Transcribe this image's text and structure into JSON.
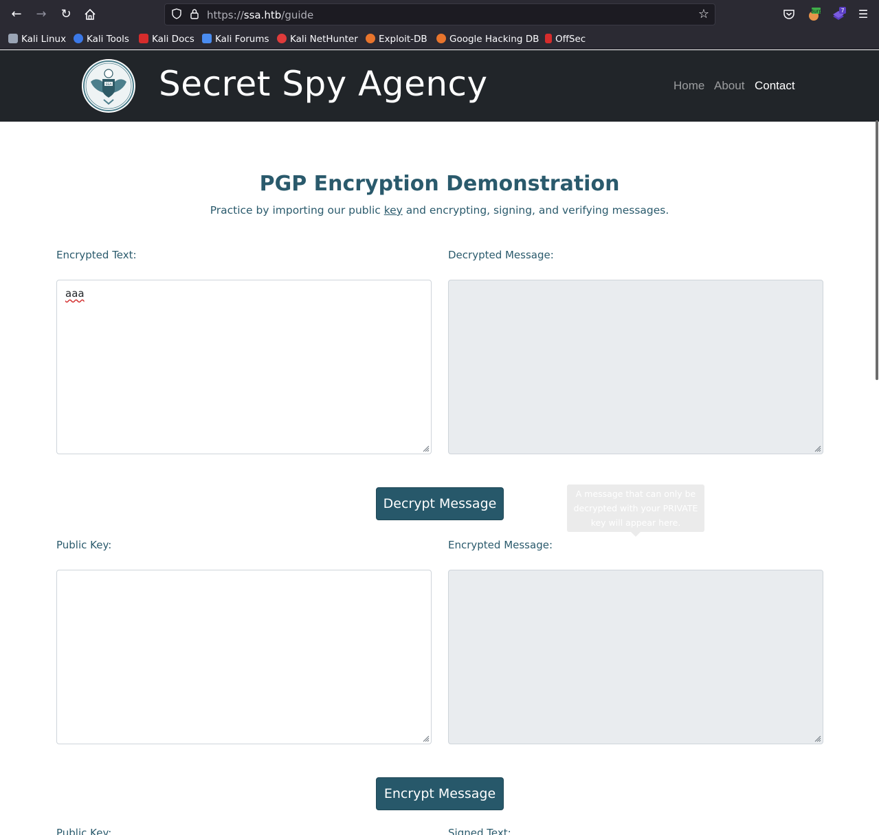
{
  "browser": {
    "url_scheme": "https://",
    "url_host": "ssa.htb",
    "url_path": "/guide",
    "bookmarks": [
      {
        "label": "Kali Linux",
        "icon": "kali-dragon-icon",
        "color": "#9aa4b5"
      },
      {
        "label": "Kali Tools",
        "icon": "kali-tools-icon",
        "color": "#3b78e7"
      },
      {
        "label": "Kali Docs",
        "icon": "kali-docs-icon",
        "color": "#d62c2c"
      },
      {
        "label": "Kali Forums",
        "icon": "kali-forums-icon",
        "color": "#4a8cf0"
      },
      {
        "label": "Kali NetHunter",
        "icon": "nethunter-icon",
        "color": "#e03b3b"
      },
      {
        "label": "Exploit-DB",
        "icon": "exploit-db-icon",
        "color": "#e8742c"
      },
      {
        "label": "Google Hacking DB",
        "icon": "ghdb-icon",
        "color": "#e8742c"
      },
      {
        "label": "OffSec",
        "icon": "offsec-icon",
        "color": "#d62c2c"
      }
    ],
    "extension_badge_burp": "Burp",
    "extension_badge_count": "7"
  },
  "site": {
    "title": "Secret Spy Agency",
    "logo_text": "SSA",
    "nav": [
      {
        "label": "Home",
        "active": false
      },
      {
        "label": "About",
        "active": false
      },
      {
        "label": "Contact",
        "active": true
      }
    ]
  },
  "main": {
    "heading": "PGP Encryption Demonstration",
    "lead_before": "Practice by importing our public ",
    "lead_link": "key",
    "lead_after": " and encrypting, signing, and verifying messages.",
    "decrypt_section": {
      "encrypted_text_label": "Encrypted Text:",
      "encrypted_text_value": "aaa",
      "decrypted_message_label": "Decrypted Message:",
      "decrypted_message_value": "",
      "button_label": "Decrypt Message",
      "tooltip": "A message that can only be decrypted with your PRIVATE key will appear here."
    },
    "encrypt_section": {
      "public_key_label": "Public Key:",
      "public_key_value": "",
      "encrypted_message_label": "Encrypted Message:",
      "encrypted_message_value": "",
      "button_label": "Encrypt Message"
    },
    "verify_section": {
      "public_key_label": "Public Key:",
      "signed_text_label": "Signed Text:"
    }
  },
  "colors": {
    "accent": "#27586a",
    "text_teal": "#2a5a6c",
    "header_bg": "#212529",
    "readonly_bg": "#e9ecef"
  }
}
